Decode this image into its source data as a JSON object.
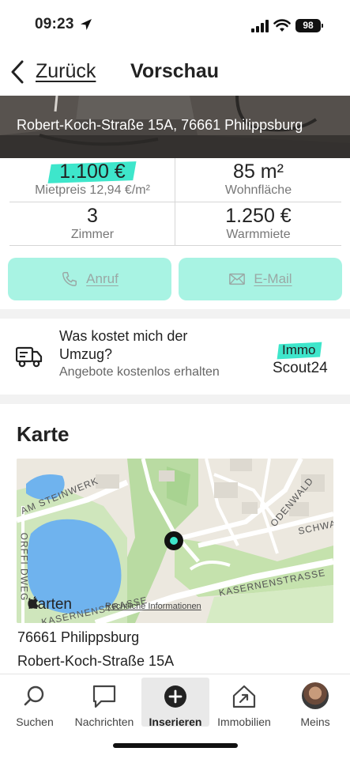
{
  "status_bar": {
    "time": "09:23",
    "battery": "98"
  },
  "nav": {
    "back_label": "Zurück",
    "title": "Vorschau"
  },
  "hero": {
    "address": "Robert-Koch-Straße 15A, 76661 Philippsburg"
  },
  "stats": {
    "price_value": "1.100 €",
    "price_label": "Mietpreis 12,94 €/m²",
    "area_value": "85 m²",
    "area_label": "Wohnfläche",
    "rooms_value": "3",
    "rooms_label": "Zimmer",
    "warm_value": "1.250 €",
    "warm_label": "Warmmiete"
  },
  "contact": {
    "call_label": "Anruf",
    "mail_label": "E-Mail"
  },
  "moving": {
    "title": "Was kostet mich der Umzug?",
    "subtitle": "Angebote kostenlos erhalten",
    "logo_immo": "Immo",
    "logo_scout": "Scout24"
  },
  "map": {
    "heading": "Karte",
    "brand": "Karten",
    "legal": "Rechtliche Informationen",
    "labels": {
      "steinwerk": "AM STEINWERK",
      "odenwald": "ODENWALD",
      "schwarz": "SCHWA",
      "kasernen1": "KASERNENSTRASSE",
      "kasernen2": "KASERNENSTRASSE",
      "orffi": "ORFFI DWEG"
    }
  },
  "address": {
    "line1": "76661 Philippsburg",
    "line2": "Robert-Koch-Straße 15A"
  },
  "tabs": [
    {
      "label": "Suchen",
      "icon": "search-icon"
    },
    {
      "label": "Nachrichten",
      "icon": "chat-icon"
    },
    {
      "label": "Inserieren",
      "icon": "plus-circle-icon"
    },
    {
      "label": "Immobilien",
      "icon": "house-icon"
    },
    {
      "label": "Meins",
      "icon": "avatar"
    }
  ],
  "colors": {
    "accent": "#3ee6cb",
    "button_bg": "#a8f3e3"
  }
}
